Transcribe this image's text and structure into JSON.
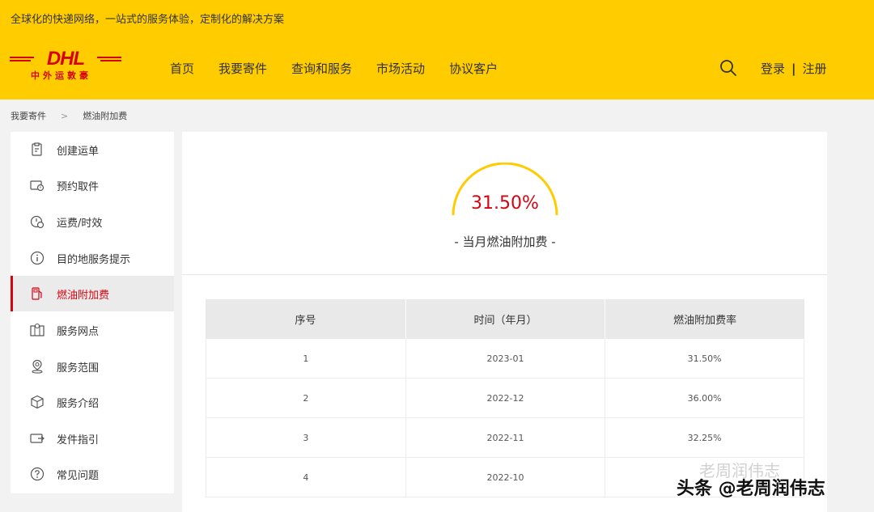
{
  "header": {
    "tagline": "全球化的快递网络，一站式的服务体验，定制化的解决方案",
    "logo_text": "DHL",
    "logo_cn": "中外运敦豪",
    "nav": [
      "首页",
      "我要寄件",
      "查询和服务",
      "市场活动",
      "协议客户"
    ],
    "login": "登录",
    "separator": "|",
    "register": "注册"
  },
  "breadcrumb": {
    "items": [
      "我要寄件",
      "燃油附加费"
    ],
    "separator": ">"
  },
  "sidebar": {
    "items": [
      {
        "label": "创建运单",
        "icon": "create-waybill-icon"
      },
      {
        "label": "预约取件",
        "icon": "schedule-pickup-icon"
      },
      {
        "label": "运费/时效",
        "icon": "rate-transit-icon"
      },
      {
        "label": "目的地服务提示",
        "icon": "info-icon"
      },
      {
        "label": "燃油附加费",
        "icon": "fuel-pump-icon",
        "active": true
      },
      {
        "label": "服务网点",
        "icon": "service-point-icon"
      },
      {
        "label": "服务范围",
        "icon": "location-pin-icon"
      },
      {
        "label": "服务介绍",
        "icon": "box-icon"
      },
      {
        "label": "发件指引",
        "icon": "shipping-guide-icon"
      },
      {
        "label": "常见问题",
        "icon": "question-icon"
      }
    ]
  },
  "fuel": {
    "value": "31.50%",
    "caption": "- 当月燃油附加费 -"
  },
  "table": {
    "headers": [
      "序号",
      "时间（年月）",
      "燃油附加费率"
    ],
    "rows": [
      [
        "1",
        "2023-01",
        "31.50%"
      ],
      [
        "2",
        "2022-12",
        "36.00%"
      ],
      [
        "3",
        "2022-11",
        "32.25%"
      ],
      [
        "4",
        "2022-10",
        ""
      ]
    ]
  },
  "watermark": {
    "text": "头条 @老周润伟志",
    "faint": "老周润伟志"
  },
  "colors": {
    "brand_yellow": "#ffcc00",
    "brand_red": "#d40511"
  }
}
